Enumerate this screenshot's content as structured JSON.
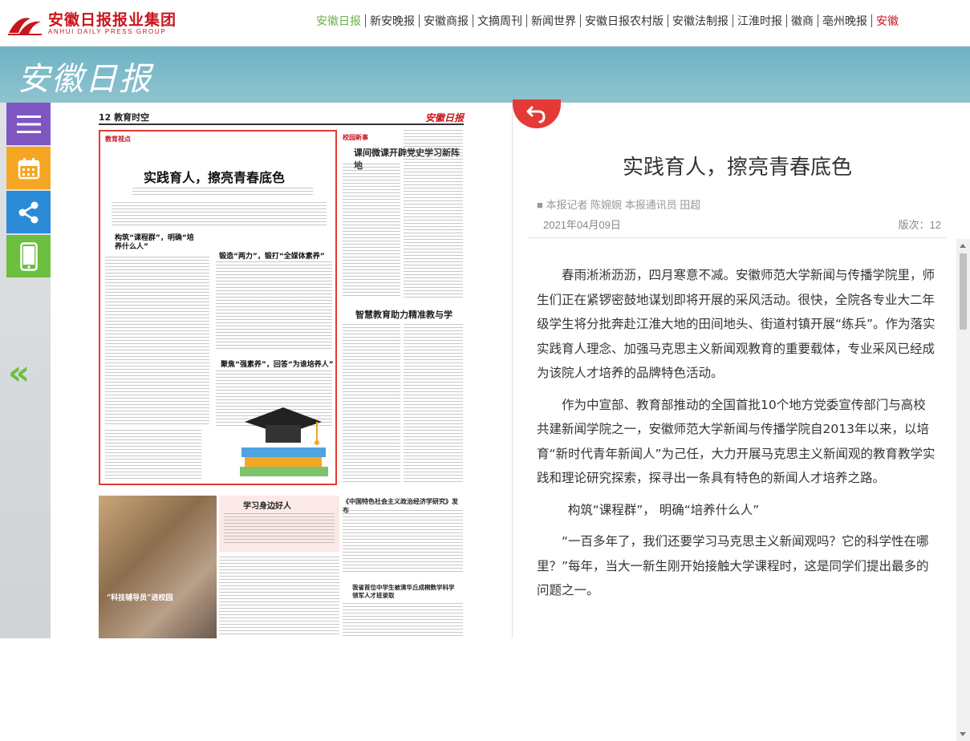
{
  "header": {
    "logo_cn": "安徽日报报业集团",
    "logo_en": "ANHUI DAILY PRESS GROUP",
    "nav": [
      "安徽日报",
      "新安晚报",
      "安徽商报",
      "文摘周刊",
      "新闻世界",
      "安徽日报农村版",
      "安徽法制报",
      "江淮时报",
      "徽商",
      "亳州晚报",
      "安徽"
    ]
  },
  "band": {
    "title": "安徽日报"
  },
  "paper": {
    "page_number": "12 教育时空",
    "masthead": "安徽日报",
    "highlight_title": "实践育人，擦亮青春底色",
    "subhead1": "构筑“课程群”，明确“培养什么人”",
    "subhead2": "锻造“两力”，锻打“全媒体素养”",
    "subhead3": "聚焦“强素养”，回答“为谁培养人”",
    "section_tag": "教育视点",
    "col2_tag": "校园新事",
    "col2_title1": "课间微课开辟党史学习新阵地",
    "col2_title2": "智慧教育助力精准教与学",
    "lower_title1": "学习身边好人",
    "lower_title2": "“科技辅导员”进校园",
    "lower_title3": "《中国特色社会主义政治经济学研究》发布",
    "lower_title4": "我省首位中学生被清华丘成桐数学科学领军人才班录取"
  },
  "article": {
    "title": "实践育人，擦亮青春底色",
    "author": "■ 本报记者 陈婉婉 本报通讯员 田超",
    "date": "2021年04月09日",
    "page": "版次：12",
    "paragraphs": [
      "春雨淅淅沥沥，四月寒意不减。安徽师范大学新闻与传播学院里，师生们正在紧锣密鼓地谋划即将开展的采风活动。很快，全院各专业大二年级学生将分批奔赴江淮大地的田间地头、街道村镇开展“练兵”。作为落实实践育人理念、加强马克思主义新闻观教育的重要载体，专业采风已经成为该院人才培养的品牌特色活动。",
      "作为中宣部、教育部推动的全国首批10个地方党委宣传部门与高校共建新闻学院之一，安徽师范大学新闻与传播学院自2013年以来，以培育“新时代青年新闻人”为己任，大力开展马克思主义新闻观的教育教学实践和理论研究探索，探寻出一条具有特色的新闻人才培养之路。",
      "构筑“课程群”， 明确“培养什么人”",
      "“一百多年了，我们还要学习马克思主义新闻观吗？它的科学性在哪里？”每年，当大一新生刚开始接触大学课程时，这是同学们提出最多的问题之一。"
    ]
  },
  "colors": {
    "brand_red": "#c8161d",
    "nav_active": "#6ab04c",
    "band": "#6fb3c4",
    "menu_btn": "#7e57c2",
    "calendar_btn": "#f5a623",
    "share_btn": "#2b8bd6",
    "mobile_btn": "#6cbf3f"
  },
  "icons": [
    "menu-icon",
    "calendar-icon",
    "share-icon",
    "mobile-icon",
    "double-chevron-left-icon",
    "return-arrow-icon"
  ]
}
